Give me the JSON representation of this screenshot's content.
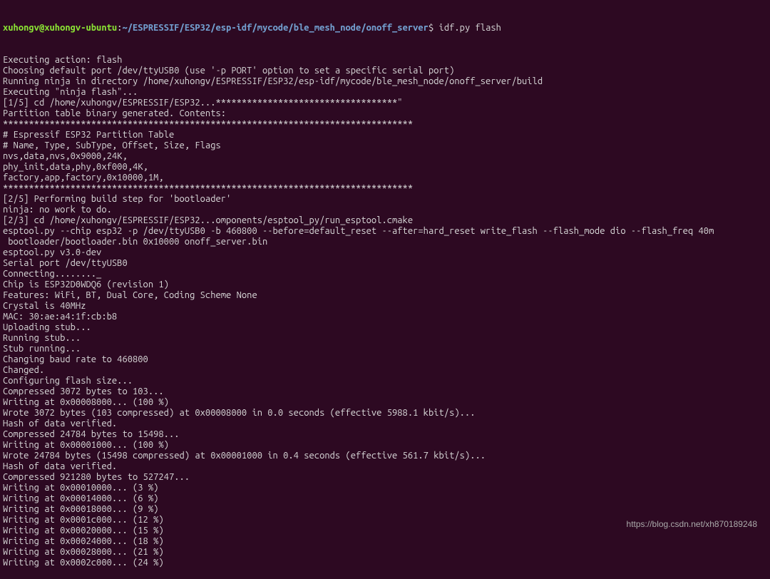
{
  "prompt": {
    "user": "xuhongv@xuhongv-ubuntu",
    "colon": ":",
    "path": "~/ESPRESSIF/ESP32/esp-idf/mycode/ble_mesh_node/onoff_server",
    "dollar": "$ ",
    "command": "idf.py flash"
  },
  "lines": [
    "Executing action: flash",
    "Choosing default port /dev/ttyUSB0 (use '-p PORT' option to set a specific serial port)",
    "Running ninja in directory /home/xuhongv/ESPRESSIF/ESP32/esp-idf/mycode/ble_mesh_node/onoff_server/build",
    "Executing \"ninja flash\"...",
    "[1/5] cd /home/xuhongv/ESPRESSIF/ESP32...***********************************\"",
    "Partition table binary generated. Contents:",
    "*******************************************************************************",
    "# Espressif ESP32 Partition Table",
    "# Name, Type, SubType, Offset, Size, Flags",
    "nvs,data,nvs,0x9000,24K,",
    "phy_init,data,phy,0xf000,4K,",
    "factory,app,factory,0x10000,1M,",
    "*******************************************************************************",
    "[2/5] Performing build step for 'bootloader'",
    "ninja: no work to do.",
    "[2/3] cd /home/xuhongv/ESPRESSIF/ESP32...omponents/esptool_py/run_esptool.cmake",
    "esptool.py --chip esp32 -p /dev/ttyUSB0 -b 460800 --before=default_reset --after=hard_reset write_flash --flash_mode dio --flash_freq 40m",
    " bootloader/bootloader.bin 0x10000 onoff_server.bin",
    "esptool.py v3.0-dev",
    "Serial port /dev/ttyUSB0",
    "Connecting........_",
    "Chip is ESP32D0WDQ6 (revision 1)",
    "Features: WiFi, BT, Dual Core, Coding Scheme None",
    "Crystal is 40MHz",
    "MAC: 30:ae:a4:1f:cb:b8",
    "Uploading stub...",
    "Running stub...",
    "Stub running...",
    "Changing baud rate to 460800",
    "Changed.",
    "Configuring flash size...",
    "Compressed 3072 bytes to 103...",
    "Writing at 0x00008000... (100 %)",
    "Wrote 3072 bytes (103 compressed) at 0x00008000 in 0.0 seconds (effective 5988.1 kbit/s)...",
    "Hash of data verified.",
    "Compressed 24784 bytes to 15498...",
    "Writing at 0x00001000... (100 %)",
    "Wrote 24784 bytes (15498 compressed) at 0x00001000 in 0.4 seconds (effective 561.7 kbit/s)...",
    "Hash of data verified.",
    "Compressed 921280 bytes to 527247...",
    "Writing at 0x00010000... (3 %)",
    "Writing at 0x00014000... (6 %)",
    "Writing at 0x00018000... (9 %)",
    "Writing at 0x0001c000... (12 %)",
    "Writing at 0x00020000... (15 %)",
    "Writing at 0x00024000... (18 %)",
    "Writing at 0x00028000... (21 %)",
    "Writing at 0x0002c000... (24 %)"
  ],
  "watermark": "https://blog.csdn.net/xh870189248"
}
